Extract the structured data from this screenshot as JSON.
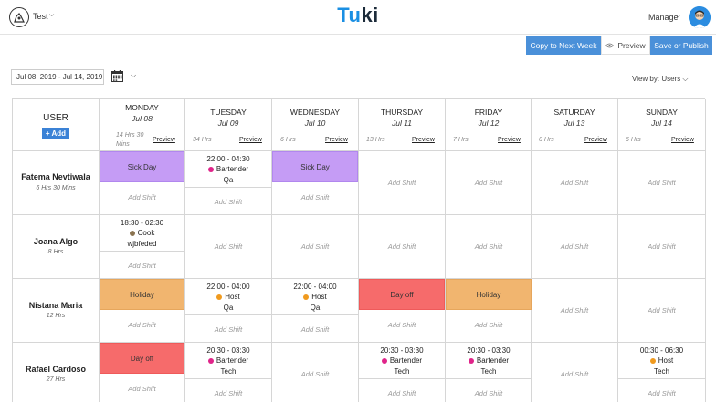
{
  "header": {
    "org_name": "Test",
    "brand_part1": "Tu",
    "brand_part2": "ki",
    "manage_label": "Manage"
  },
  "actions": {
    "copy_label": "Copy to Next Week",
    "preview_label": "Preview",
    "publish_label": "Save or Publish"
  },
  "toolbar": {
    "date_range": "Jul 08, 2019 - Jul 14, 2019",
    "view_by": "View by: Users"
  },
  "grid": {
    "user_header": "USER",
    "add_label": "+ Add",
    "add_shift_label": "Add Shift",
    "preview_link": "Preview",
    "days": [
      {
        "name": "MONDAY",
        "date": "Jul 08",
        "hours": "14 Hrs 30 Mins"
      },
      {
        "name": "TUESDAY",
        "date": "Jul 09",
        "hours": "34 Hrs"
      },
      {
        "name": "WEDNESDAY",
        "date": "Jul 10",
        "hours": "6 Hrs"
      },
      {
        "name": "THURSDAY",
        "date": "Jul 11",
        "hours": "13 Hrs"
      },
      {
        "name": "FRIDAY",
        "date": "Jul 12",
        "hours": "7 Hrs"
      },
      {
        "name": "SATURDAY",
        "date": "Jul 13",
        "hours": "0 Hrs"
      },
      {
        "name": "SUNDAY",
        "date": "Jul 14",
        "hours": "6 Hrs"
      }
    ],
    "employees": [
      {
        "name": "Fatema Nevtiwala",
        "hours": "6 Hrs 30 Mins"
      },
      {
        "name": "Joana Algo",
        "hours": "8 Hrs"
      },
      {
        "name": "Nistana Maria",
        "hours": "12 Hrs"
      },
      {
        "name": "Rafael Cardoso",
        "hours": "27 Hrs"
      }
    ],
    "blocks": {
      "sick_day": "Sick Day",
      "holiday": "Holiday",
      "day_off": "Day off"
    },
    "shifts": {
      "fatema_tue": {
        "time": "22:00 - 04:30",
        "role": "Bartender",
        "location": "Qa"
      },
      "joana_mon": {
        "time": "18:30 - 02:30",
        "role": "Cook",
        "location": "wjbfeded"
      },
      "nistana_tue": {
        "time": "22:00 - 04:00",
        "role": "Host",
        "location": "Qa"
      },
      "nistana_wed": {
        "time": "22:00 - 04:00",
        "role": "Host",
        "location": "Qa"
      },
      "rafael_tue": {
        "time": "20:30 - 03:30",
        "role": "Bartender",
        "location": "Tech"
      },
      "rafael_thu": {
        "time": "20:30 - 03:30",
        "role": "Bartender",
        "location": "Tech"
      },
      "rafael_fri": {
        "time": "20:30 - 03:30",
        "role": "Bartender",
        "location": "Tech"
      },
      "rafael_sun": {
        "time": "00:30 - 06:30",
        "role": "Host",
        "location": "Tech"
      }
    }
  },
  "colors": {
    "accent": "#4a90d9",
    "sick": "#c59cf5",
    "holiday": "#f1b56f",
    "day_off": "#f66b6b",
    "bartender_dot": "#e0248a",
    "cook_dot": "#8a7350",
    "host_dot": "#f09a1e"
  }
}
